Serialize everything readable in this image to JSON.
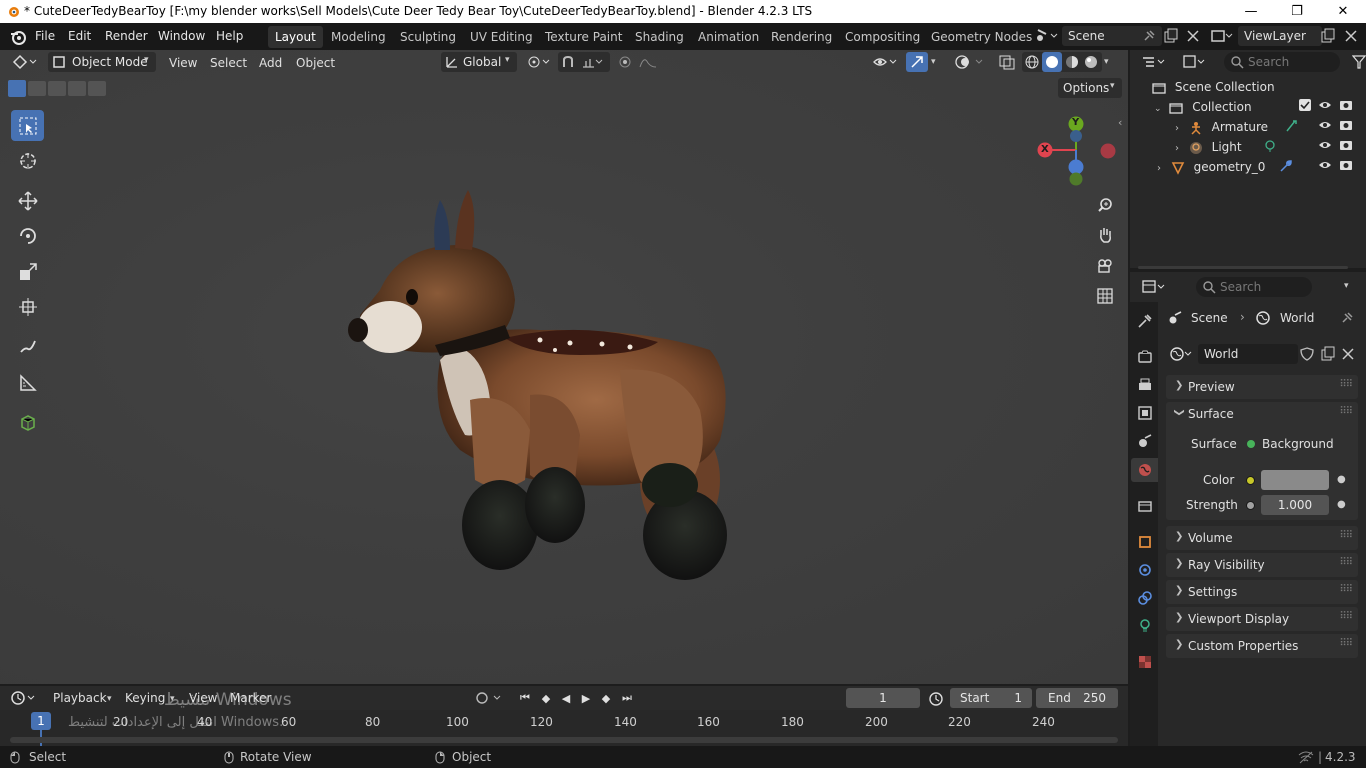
{
  "window": {
    "title": "* CuteDeerTedyBearToy [F:\\my blender works\\Sell Models\\Cute Deer Tedy Bear Toy\\CuteDeerTedyBearToy.blend] - Blender 4.2.3 LTS",
    "minimize": "—",
    "maximize": "❐",
    "close": "✕"
  },
  "menu": [
    "File",
    "Edit",
    "Render",
    "Window",
    "Help"
  ],
  "workspaces": [
    {
      "label": "Layout",
      "active": true
    },
    {
      "label": "Modeling"
    },
    {
      "label": "Sculpting"
    },
    {
      "label": "UV Editing"
    },
    {
      "label": "Texture Paint"
    },
    {
      "label": "Shading"
    },
    {
      "label": "Animation"
    },
    {
      "label": "Rendering"
    },
    {
      "label": "Compositing"
    },
    {
      "label": "Geometry Nodes"
    }
  ],
  "scene_field": "Scene",
  "viewlayer_field": "ViewLayer",
  "viewport_header": {
    "mode": "Object Mode",
    "view": "View",
    "select": "Select",
    "add": "Add",
    "object": "Object",
    "transform_orientation": "Global",
    "options": "Options"
  },
  "gizmo": {
    "x": "X",
    "y": "Y"
  },
  "outliner": {
    "search_placeholder": "Search",
    "scene_collection": "Scene Collection",
    "collection": "Collection",
    "armature": "Armature",
    "light": "Light",
    "geometry": "geometry_0"
  },
  "properties": {
    "search_placeholder": "Search",
    "breadcrumb_scene": "Scene",
    "breadcrumb_world": "World",
    "world_name": "World",
    "preview": "Preview",
    "surface": "Surface",
    "surface_label": "Surface",
    "surface_value": "Background",
    "color_label": "Color",
    "strength_label": "Strength",
    "strength_value": "1.000",
    "volume": "Volume",
    "ray_visibility": "Ray Visibility",
    "settings": "Settings",
    "viewport_display": "Viewport Display",
    "custom_properties": "Custom Properties"
  },
  "timeline": {
    "playback": "Playback",
    "keying": "Keying",
    "view": "View",
    "marker": "Marker",
    "current_frame": "1",
    "start_label": "Start",
    "start_value": "1",
    "end_label": "End",
    "end_value": "250",
    "playhead": "1",
    "ticks": [
      "20",
      "40",
      "60",
      "80",
      "100",
      "120",
      "140",
      "160",
      "180",
      "200",
      "220",
      "240"
    ]
  },
  "watermark": {
    "line1": "تنشيط Windows",
    "line2": "انتقل إلى الإعدادات لتنشيط Windows."
  },
  "statusbar": {
    "select": "Select",
    "rotate_view": "Rotate View",
    "object": "Object",
    "version": "4.2.3"
  },
  "colors": {
    "accent": "#4772b3",
    "bg_dark": "#181818",
    "viewport": "#3f3f3f",
    "x_axis": "#e0444f",
    "y_axis": "#6aa81f",
    "z_axis": "#4b7cd1"
  }
}
